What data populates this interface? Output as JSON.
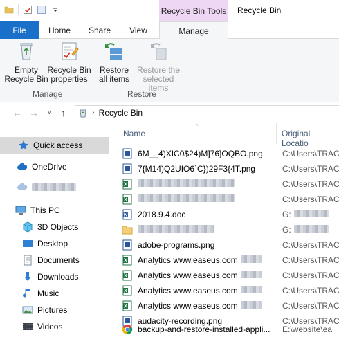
{
  "title_bar": {
    "context_tab_label": "Recycle Bin Tools",
    "window_title": "Recycle Bin"
  },
  "ribbon_tabs": [
    "File",
    "Home",
    "Share",
    "View",
    "Manage"
  ],
  "ribbon": {
    "buttons": [
      {
        "label": "Empty Recycle Bin",
        "enabled": true,
        "icon": "recycle-bin-icon"
      },
      {
        "label": "Recycle Bin properties",
        "enabled": true,
        "icon": "properties-icon"
      },
      {
        "label": "Restore all items",
        "enabled": true,
        "icon": "restore-all-icon"
      },
      {
        "label": "Restore the selected items",
        "enabled": false,
        "icon": "restore-selected-icon"
      }
    ],
    "groups": [
      "Manage",
      "Restore"
    ]
  },
  "address": {
    "path": "Recycle Bin"
  },
  "navpane": {
    "items": [
      {
        "label": "Quick access",
        "icon": "star-icon",
        "selected": true
      },
      {
        "label": "OneDrive",
        "icon": "cloud-icon"
      },
      {
        "label": "",
        "icon": "network-cloud-icon",
        "redacted": true
      },
      {
        "label": "This PC",
        "icon": "computer-icon"
      },
      {
        "label": "3D Objects",
        "icon": "cube-icon"
      },
      {
        "label": "Desktop",
        "icon": "desktop-icon"
      },
      {
        "label": "Documents",
        "icon": "documents-icon"
      },
      {
        "label": "Downloads",
        "icon": "download-icon"
      },
      {
        "label": "Music",
        "icon": "music-icon"
      },
      {
        "label": "Pictures",
        "icon": "pictures-icon"
      },
      {
        "label": "Videos",
        "icon": "videos-icon"
      }
    ]
  },
  "filelist": {
    "columns": [
      "Name",
      "Original Locatio"
    ],
    "rows": [
      {
        "name": "6M__4)XIC0$24)M]76]OQBO.png",
        "location": "C:\\Users\\TRACY",
        "icon": "image-file-icon"
      },
      {
        "name": "7{M14)Q2UIO6`C})29F3{4T.png",
        "location": "C:\\Users\\TRACY",
        "icon": "image-file-icon"
      },
      {
        "name": "",
        "location": "C:\\Users\\TRACY",
        "icon": "excel-file-icon",
        "redacted": true
      },
      {
        "name": "",
        "location": "C:\\Users\\TRACY",
        "icon": "excel-file-icon",
        "redacted": true
      },
      {
        "name": "2018.9.4.doc",
        "location": "G:",
        "icon": "word-file-icon"
      },
      {
        "name": "",
        "location": "G:",
        "icon": "folder-icon",
        "redacted": true
      },
      {
        "name": "adobe-programs.png",
        "location": "C:\\Users\\TRACY",
        "icon": "image-file-icon"
      },
      {
        "name": "Analytics www.easeus.com",
        "location": "C:\\Users\\TRACY",
        "icon": "excel-file-icon"
      },
      {
        "name": "Analytics www.easeus.com",
        "location": "C:\\Users\\TRACY",
        "icon": "excel-file-icon"
      },
      {
        "name": "Analytics www.easeus.com",
        "location": "C:\\Users\\TRACY",
        "icon": "excel-file-icon"
      },
      {
        "name": "Analytics www.easeus.com",
        "location": "C:\\Users\\TRACY",
        "icon": "excel-file-icon"
      },
      {
        "name": "audacity-recording.png",
        "location": "C:\\Users\\TRACY",
        "icon": "image-file-icon"
      },
      {
        "name": "backup-and-restore-installed-appli...",
        "location": "E:\\website\\ea",
        "icon": "chrome-file-icon"
      }
    ]
  },
  "colors": {
    "file_tab": "#1a6fc9",
    "context_tab": "#eed7f5",
    "selected_nav": "#d9d9d9",
    "column_header_text": "#4c607a"
  }
}
